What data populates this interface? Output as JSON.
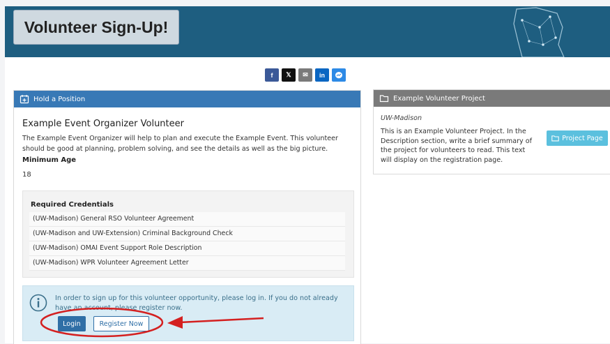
{
  "header": {
    "title": "Volunteer Sign-Up!"
  },
  "share": [
    {
      "label": "f",
      "icon": "facebook-icon",
      "color": "#3b5998"
    },
    {
      "label": "𝕏",
      "icon": "x-icon",
      "color": "#111111"
    },
    {
      "label": "✉",
      "icon": "email-icon",
      "color": "#7a7a7a"
    },
    {
      "label": "in",
      "icon": "linkedin-icon",
      "color": "#0a66c2"
    },
    {
      "label": "",
      "icon": "messenger-icon",
      "color": "#2d8ae6"
    }
  ],
  "position": {
    "panel_title": "Hold a Position",
    "title": "Example Event Organizer Volunteer",
    "description": "The Example Event Organizer will help to plan and execute the Example Event. This volunteer should be good at planning, problem solving, and see the details as well as the big picture.",
    "min_age_label": "Minimum Age",
    "min_age": "18",
    "credentials_title": "Required Credentials",
    "credentials": [
      "(UW-Madison) General RSO Volunteer Agreement",
      "(UW-Madison and UW-Extension) Criminal Background Check",
      "(UW-Madison) OMAI Event Support Role Description",
      "(UW-Madison) WPR Volunteer Agreement Letter"
    ],
    "login_message": "In order to sign up for this volunteer opportunity, please log in. If you do not already have an account, please register now.",
    "login_label": "Login",
    "register_label": "Register Now"
  },
  "project": {
    "panel_title": "Example Volunteer Project",
    "organization": "UW-Madison",
    "description": "This is an Example Volunteer Project. In the Description section, write a brief summary of the project for volunteers to read. This text will display on the registration page.",
    "button_label": "Project Page"
  },
  "colors": {
    "header_bg": "#1e5e80",
    "position_header": "#3879b6",
    "project_header": "#7a7a7a",
    "annotation": "#d42020"
  }
}
